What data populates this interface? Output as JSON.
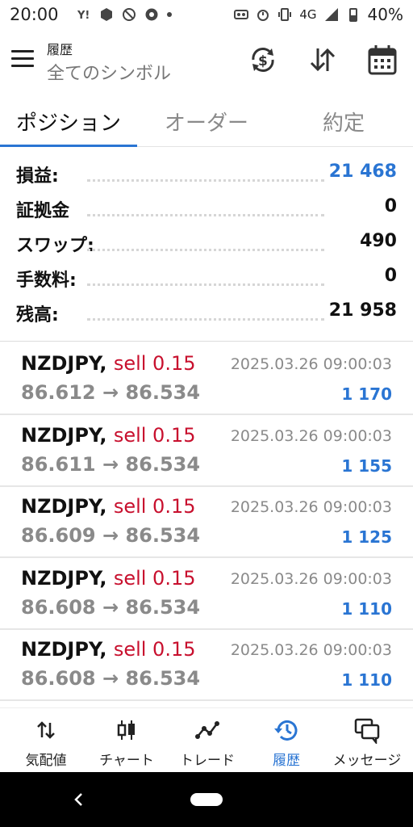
{
  "status_bar": {
    "time": "20:00",
    "network": "4G",
    "battery": "40%"
  },
  "app_bar": {
    "title": "履歴",
    "subtitle": "全てのシンボル"
  },
  "tabs": [
    "ポジション",
    "オーダー",
    "約定"
  ],
  "summary": [
    {
      "label": "損益:",
      "value": "21 468",
      "highlight": true
    },
    {
      "label": "証拠金",
      "value": "0",
      "highlight": false
    },
    {
      "label": "スワップ:",
      "value": "490",
      "highlight": false
    },
    {
      "label": "手数料:",
      "value": "0",
      "highlight": false
    },
    {
      "label": "残高:",
      "value": "21 958",
      "highlight": false
    }
  ],
  "trades": [
    {
      "symbol": "NZDJPY,",
      "side": "sell 0.15",
      "time": "2025.03.26 09:00:03",
      "open": "86.612",
      "close": "86.534",
      "profit": "1 170"
    },
    {
      "symbol": "NZDJPY,",
      "side": "sell 0.15",
      "time": "2025.03.26 09:00:03",
      "open": "86.611",
      "close": "86.534",
      "profit": "1 155"
    },
    {
      "symbol": "NZDJPY,",
      "side": "sell 0.15",
      "time": "2025.03.26 09:00:03",
      "open": "86.609",
      "close": "86.534",
      "profit": "1 125"
    },
    {
      "symbol": "NZDJPY,",
      "side": "sell 0.15",
      "time": "2025.03.26 09:00:03",
      "open": "86.608",
      "close": "86.534",
      "profit": "1 110"
    },
    {
      "symbol": "NZDJPY,",
      "side": "sell 0.15",
      "time": "2025.03.26 09:00:03",
      "open": "86.608",
      "close": "86.534",
      "profit": "1 110"
    }
  ],
  "bottom_nav": [
    {
      "label": "気配値",
      "icon": "quotes-arrows-icon"
    },
    {
      "label": "チャート",
      "icon": "candlestick-icon"
    },
    {
      "label": "トレード",
      "icon": "trade-line-icon"
    },
    {
      "label": "履歴",
      "icon": "history-clock-icon",
      "active": true
    },
    {
      "label": "メッセージ",
      "icon": "chat-bubbles-icon"
    }
  ],
  "colors": {
    "accent": "#2a75d3",
    "sell": "#c8102e",
    "muted": "#8a8a8a"
  }
}
